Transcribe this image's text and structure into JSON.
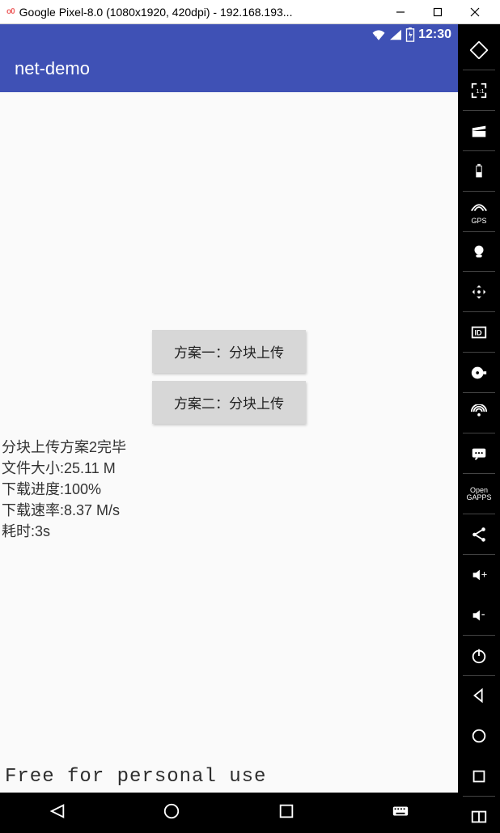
{
  "host": {
    "title": "Google Pixel-8.0 (1080x1920, 420dpi) - 192.168.193...",
    "logo": "o0"
  },
  "status": {
    "time": "12:30"
  },
  "app": {
    "title": "net-demo"
  },
  "buttons": {
    "opt1": "方案一：分块上传",
    "opt2": "方案二：分块上传"
  },
  "log": {
    "l1": "分块上传方案2完毕",
    "l2": "文件大小:25.11 M",
    "l3": "下载进度:100%",
    "l4": "下载速率:8.37 M/s",
    "l5": "耗时:3s"
  },
  "watermark": "Free for personal use",
  "toolbar": {
    "gps": "GPS",
    "id": "ID",
    "gapps1": "Open",
    "gapps2": "GAPPS"
  }
}
